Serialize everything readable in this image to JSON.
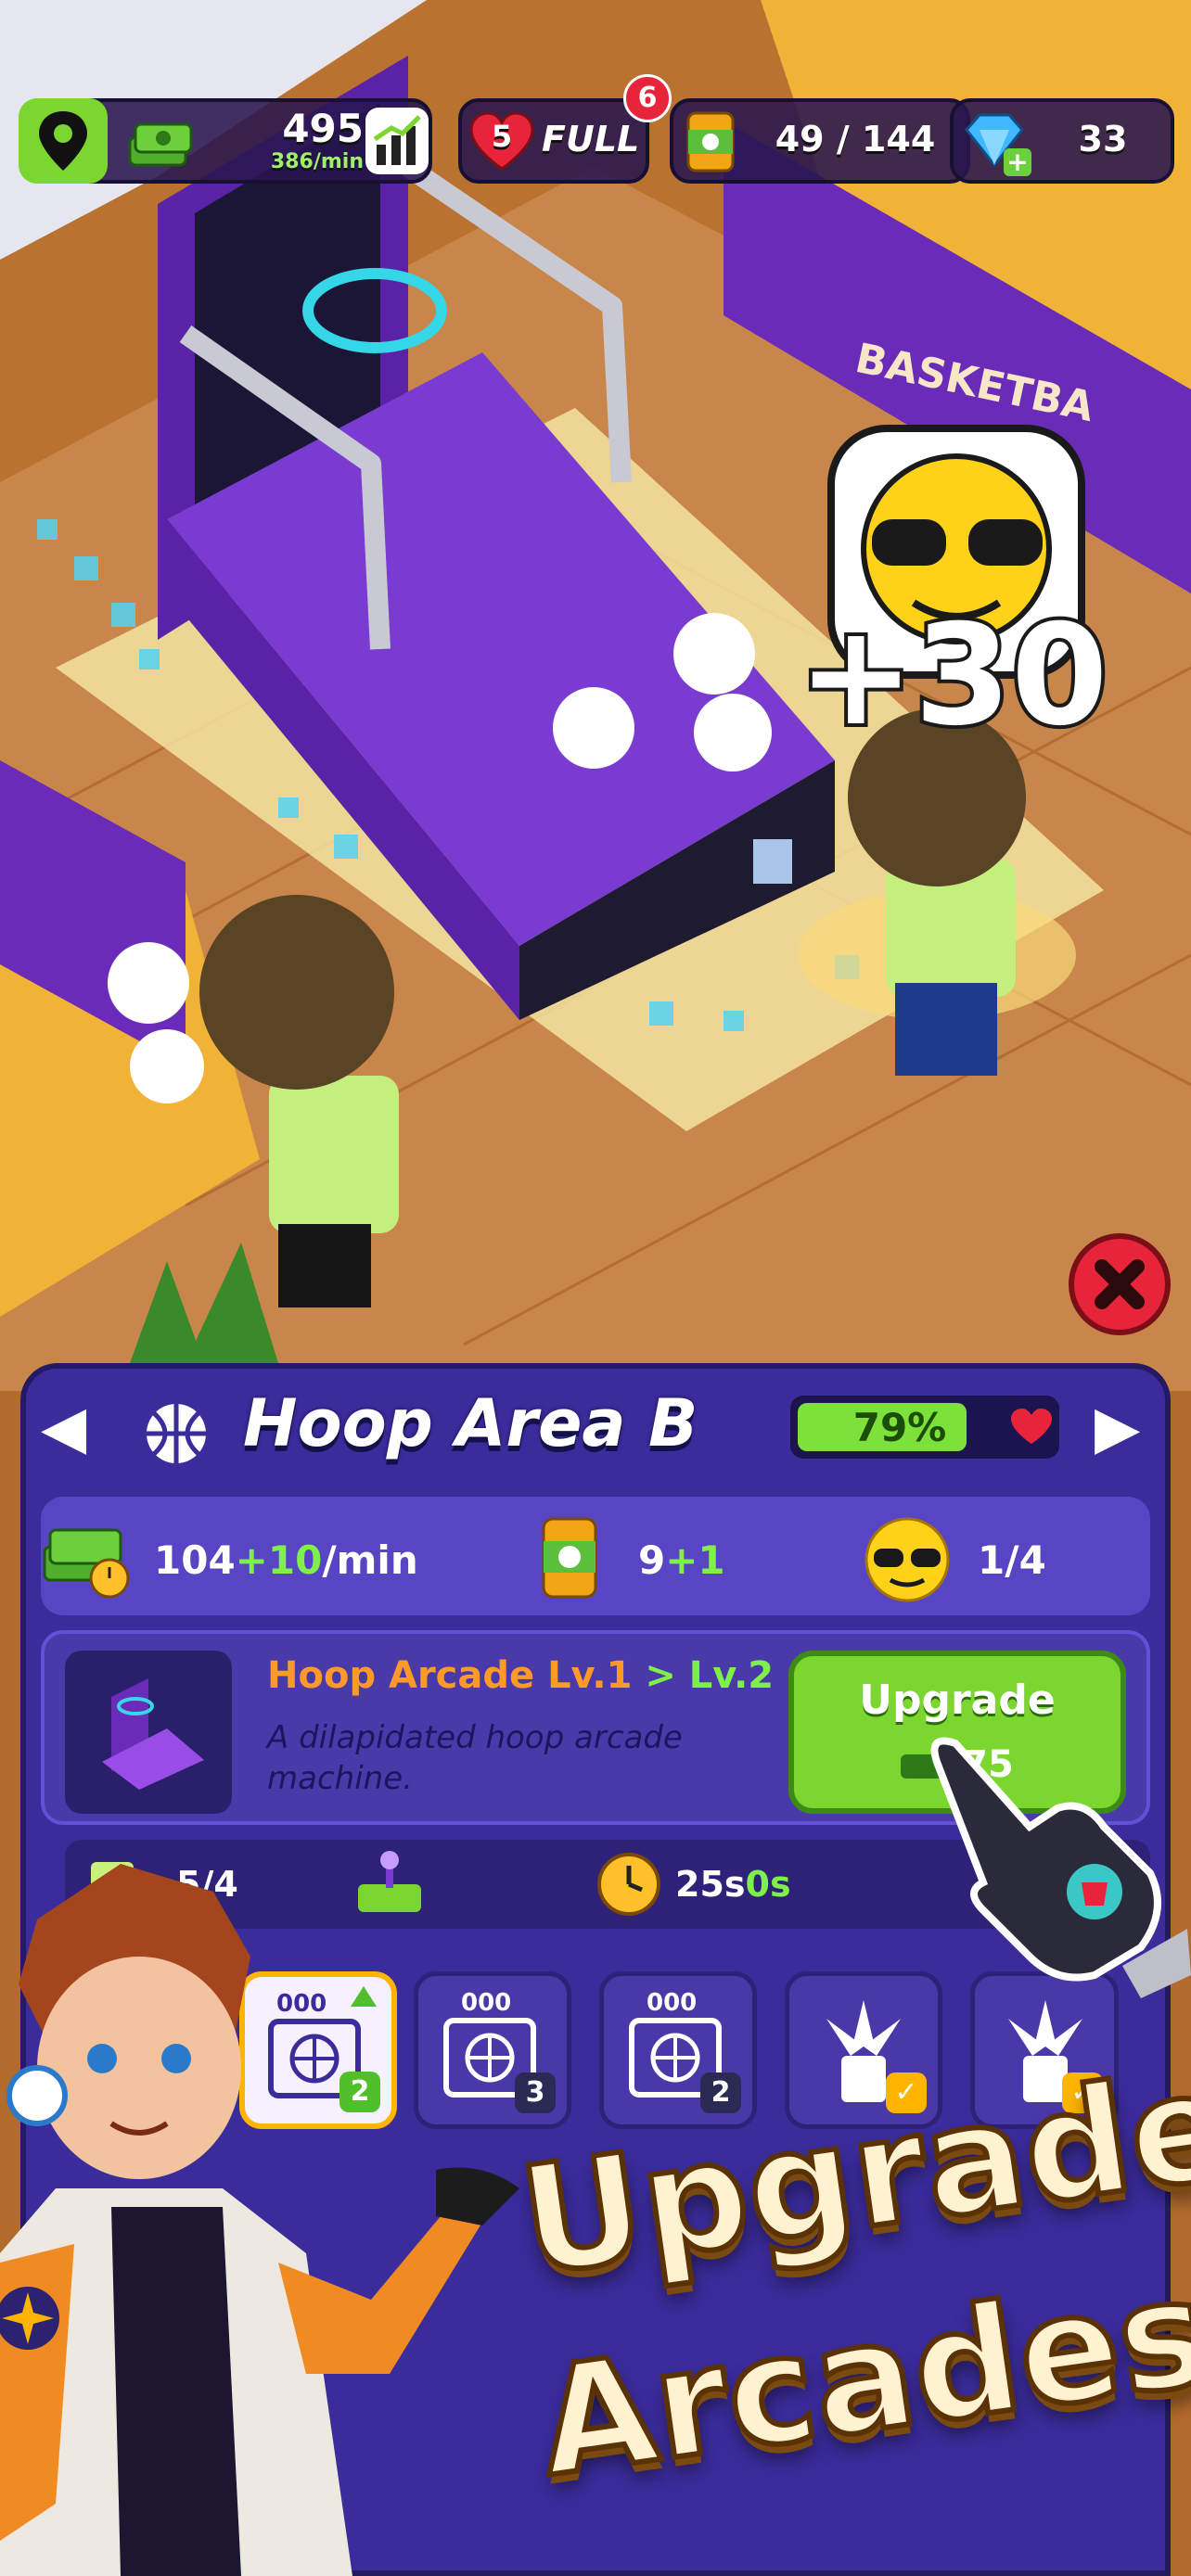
{
  "hud": {
    "cash_value": "495",
    "cash_rate": "386/min",
    "lives_count": "5",
    "lives_status": "FULL",
    "notification_count": "6",
    "supplies": "49 / 144",
    "gems": "33"
  },
  "scene": {
    "popup_bonus": "+30",
    "backdrop_sign": "BASKETBA"
  },
  "panel": {
    "area_title": "Hoop Area B",
    "happiness_percent": "79%",
    "happiness_value": 0.79,
    "income_base": "104",
    "income_bonus": "+10",
    "income_unit": "/min",
    "supply_base": "9",
    "supply_bonus": "+1",
    "visitors": "1/4",
    "machine_name": "Hoop Arcade Lv.1",
    "machine_next_level": " > Lv.2",
    "machine_desc": "A dilapidated hoop arcade machine.",
    "upgrade_label": "Upgrade",
    "upgrade_cost": "75",
    "info_capacity": "5/4",
    "info_time_a": "25s",
    "info_time_b": "0s",
    "slots": [
      {
        "counter": "000",
        "badge": "2"
      },
      {
        "counter": "000",
        "badge": "3"
      },
      {
        "counter": "000",
        "badge": "2"
      }
    ]
  },
  "promo": {
    "line1": "Upgrade",
    "line2": "Arcades"
  },
  "colors": {
    "panel": "#3b2c9c",
    "accent_green": "#7bd630",
    "floor": "#b36a2d",
    "machine_purple": "#6a2bb8"
  }
}
